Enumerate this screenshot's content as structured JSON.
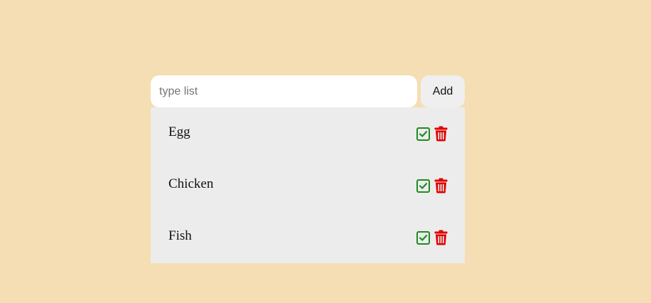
{
  "input": {
    "placeholder": "type list",
    "value": ""
  },
  "add_button": {
    "label": "Add"
  },
  "items": [
    {
      "label": "Egg"
    },
    {
      "label": "Chicken"
    },
    {
      "label": "Fish"
    }
  ],
  "colors": {
    "background": "#f5deb3",
    "list_background": "#ececec",
    "check_icon": "#1f8a1f",
    "trash_icon": "#e00000"
  },
  "icons": {
    "complete": "check-square-icon",
    "delete": "trash-icon"
  }
}
